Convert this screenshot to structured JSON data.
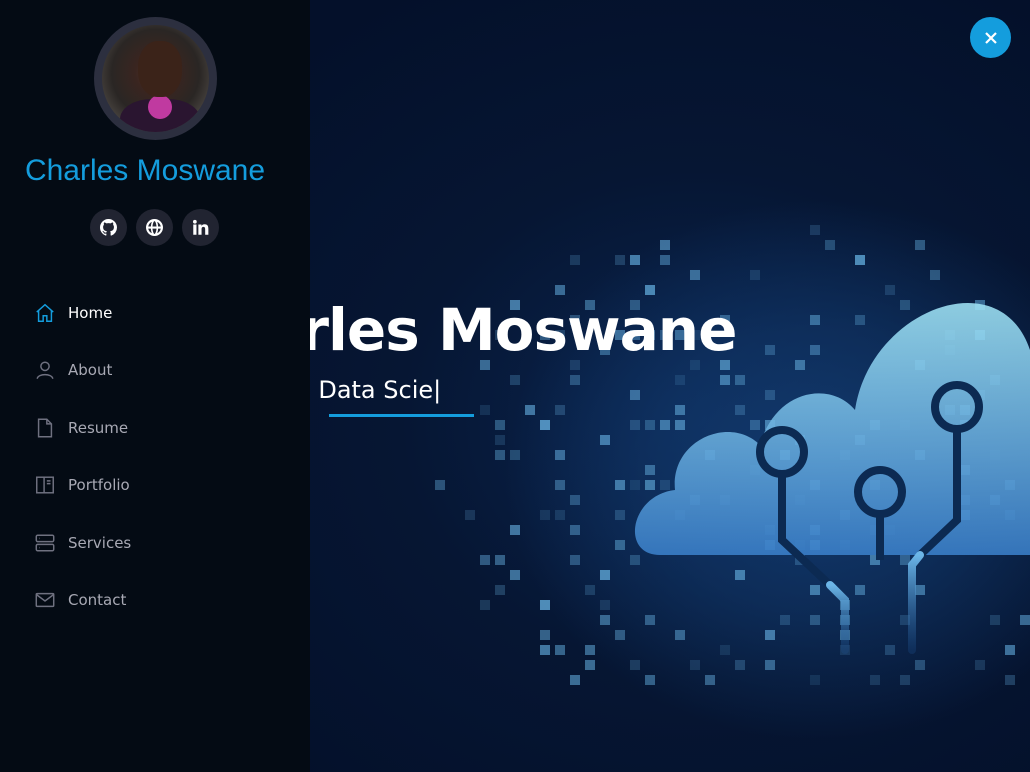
{
  "profile": {
    "name": "Charles Moswane"
  },
  "socials": [
    {
      "icon": "github-icon"
    },
    {
      "icon": "globe-icon"
    },
    {
      "icon": "linkedin-icon"
    }
  ],
  "nav": {
    "items": [
      {
        "label": "Home",
        "icon": "home-icon",
        "active": true
      },
      {
        "label": "About",
        "icon": "user-icon",
        "active": false
      },
      {
        "label": "Resume",
        "icon": "file-icon",
        "active": false
      },
      {
        "label": "Portfolio",
        "icon": "book-icon",
        "active": false
      },
      {
        "label": "Services",
        "icon": "server-icon",
        "active": false
      },
      {
        "label": "Contact",
        "icon": "envelope-icon",
        "active": false
      }
    ]
  },
  "hero": {
    "title": "harles Moswane",
    "subtitle_typed": "a Data Scie",
    "cursor": "|"
  },
  "colors": {
    "accent": "#149ddd",
    "sidebar_bg": "#040b14",
    "social_bg": "#212431"
  },
  "close_button": {
    "icon": "close-icon"
  }
}
